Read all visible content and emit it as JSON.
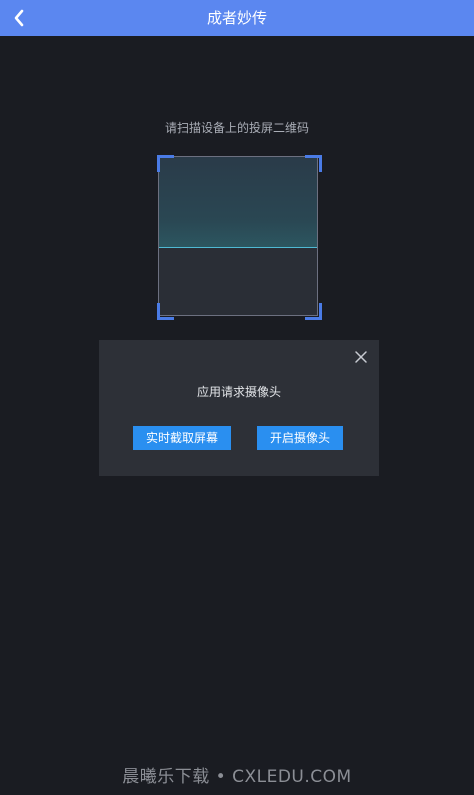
{
  "header": {
    "title": "成者妙传",
    "back_icon": "chevron-left-icon"
  },
  "scanner": {
    "hint": "请扫描设备上的投屏二维码",
    "accent_color": "#4a7be6",
    "scan_line_color": "#4fb9d4"
  },
  "dialog": {
    "message": "应用请求摄像头",
    "close_icon": "close-icon",
    "buttons": {
      "capture_label": "实时截取屏幕",
      "camera_label": "开启摄像头"
    },
    "button_color": "#2a8ff0"
  },
  "watermark": {
    "text": "晨曦乐下载 • CXLEDU.COM"
  },
  "colors": {
    "header_bg": "#5b87f0",
    "page_bg": "#1a1c22",
    "dialog_bg": "#2d3037"
  }
}
